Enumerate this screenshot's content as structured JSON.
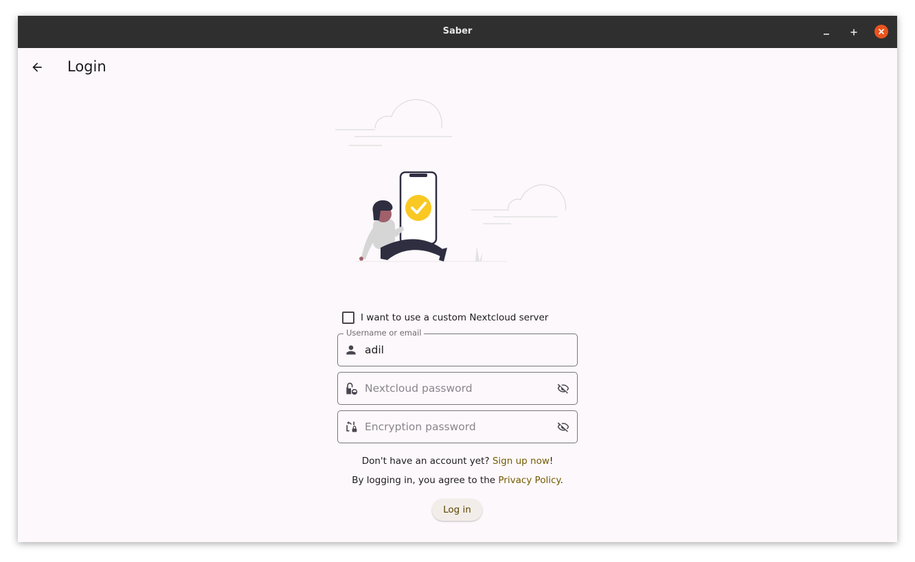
{
  "window": {
    "title": "Saber"
  },
  "appbar": {
    "title": "Login"
  },
  "form": {
    "custom_server_label": "I want to use a custom Nextcloud server",
    "custom_server_checked": false,
    "username": {
      "label": "Username or email",
      "value": "adil"
    },
    "nextcloud_password": {
      "placeholder": "Nextcloud password"
    },
    "encryption_password": {
      "placeholder": "Encryption password"
    },
    "signup_prefix": "Don't have an account yet? ",
    "signup_link": "Sign up now",
    "signup_suffix": "!",
    "privacy_prefix": "By logging in, you agree to the ",
    "privacy_link": "Privacy Policy",
    "privacy_suffix": ".",
    "login_button": "Log in"
  },
  "icons": {
    "back": "arrow-left-icon",
    "minimize": "minimize-icon",
    "maximize": "maximize-icon",
    "close": "close-icon",
    "username": "person-icon",
    "nextcloud_password": "lock-cloud-icon",
    "encryption_password": "lock-reset-icon",
    "visibility": "eye-off-icon"
  },
  "colors": {
    "titlebar": "#2f2f2f",
    "close_button": "#e95420",
    "background": "#fdf8fb",
    "link": "#745b00",
    "accent_check": "#f9c823"
  }
}
